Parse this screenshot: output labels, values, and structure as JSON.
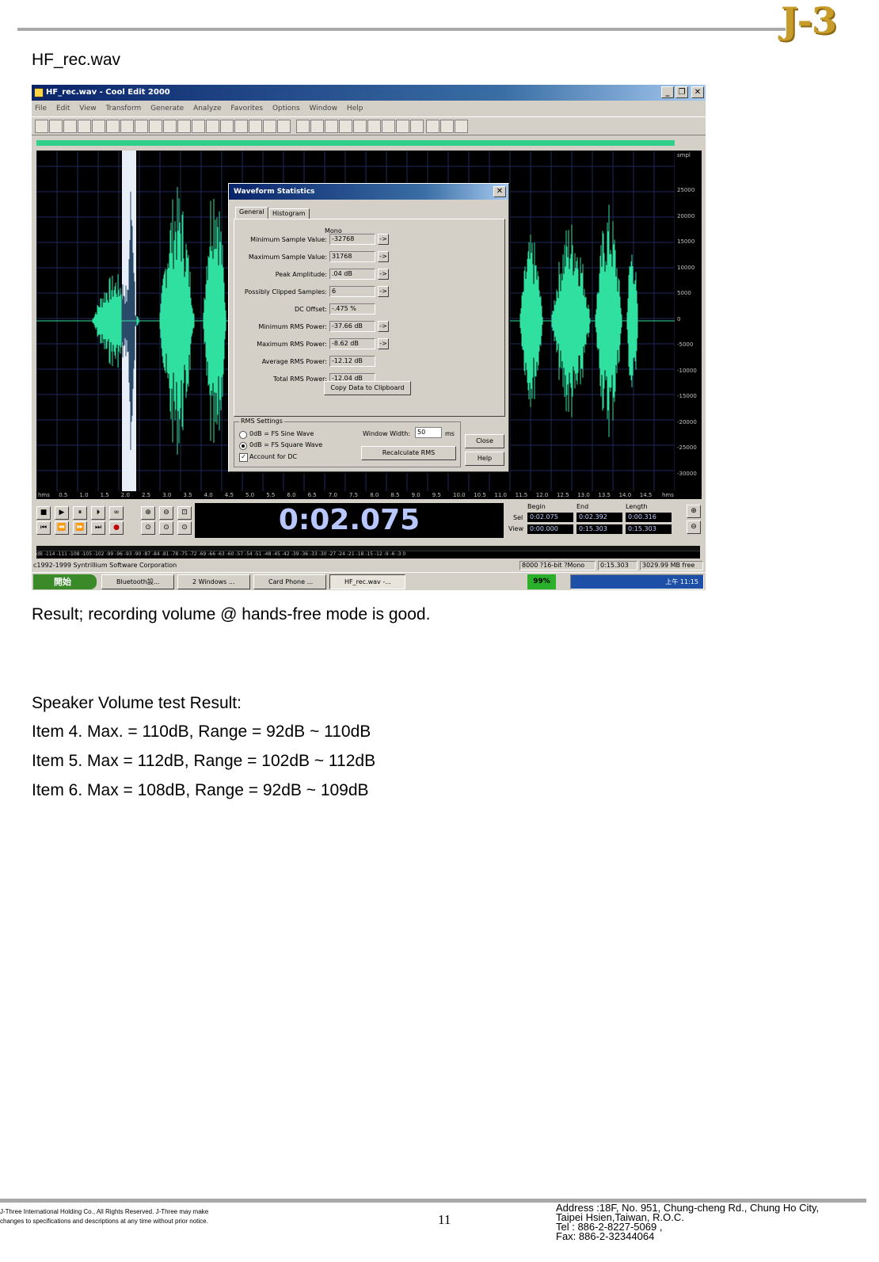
{
  "header": {
    "logo": "J-3",
    "doc_title": "HF_rec.wav"
  },
  "window": {
    "title": "HF_rec.wav - Cool Edit 2000",
    "menu": [
      "File",
      "Edit",
      "View",
      "Transform",
      "Generate",
      "Analyze",
      "Favorites",
      "Options",
      "Window",
      "Help"
    ],
    "scale_labels": [
      "smpl",
      "25000",
      "20000",
      "15000",
      "10000",
      "5000",
      "0",
      "-5000",
      "-10000",
      "-15000",
      "-20000",
      "-25000",
      "-30000"
    ],
    "ruler_labels": [
      "hms",
      "0.5",
      "1.0",
      "1.5",
      "2.0",
      "2.5",
      "3.0",
      "3.5",
      "4.0",
      "4.5",
      "5.0",
      "5.5",
      "6.0",
      "6.5",
      "7.0",
      "7.5",
      "8.0",
      "8.5",
      "9.0",
      "9.5",
      "10.0",
      "10.5",
      "11.0",
      "11.5",
      "12.0",
      "12.5",
      "13.0",
      "13.5",
      "14.0",
      "14.5",
      "hms"
    ],
    "time_display": "0:02.075",
    "selection": {
      "begin_label": "Begin",
      "end_label": "End",
      "length_label": "Length",
      "sel_label": "Sel",
      "view_label": "View",
      "sel_begin": "0:02.075",
      "sel_end": "0:02.392",
      "sel_length": "0:00.316",
      "view_begin": "0:00.000",
      "view_end": "0:15.303",
      "view_length": "0:15.303"
    },
    "level_scale": "dB  -114 -111 -108 -105 -102 -99 -96 -93 -90 -87 -84 -81 -78 -75 -72 -69 -66 -63 -60 -57 -54 -51 -48 -45 -42 -39 -36 -33 -30 -27 -24 -21 -18 -15 -12 -9 -6 -3 0",
    "status": {
      "copyright": "c1992-1999 Syntrillium Software Corporation",
      "format": "8000 ?16-bit ?Mono",
      "duration": "0:15.303",
      "free": "3029.99 MB free"
    },
    "taskbar": {
      "start": "開始",
      "tasks": [
        "Bluetooth設...",
        "2 Windows ...",
        "Card Phone ...",
        "HF_rec.wav -..."
      ],
      "battery": "99%",
      "clock": "上午 11:15"
    }
  },
  "dialog": {
    "title": "Waveform Statistics",
    "tabs": [
      "General",
      "Histogram"
    ],
    "channel": "Mono",
    "rows": [
      {
        "label": "Minimum Sample Value:",
        "value": "-32768",
        "arrow": "->"
      },
      {
        "label": "Maximum Sample Value:",
        "value": "31768",
        "arrow": "->"
      },
      {
        "label": "Peak Amplitude:",
        "value": ".04 dB",
        "arrow": "->"
      },
      {
        "label": "Possibly Clipped Samples:",
        "value": "6",
        "arrow": "->"
      },
      {
        "label": "DC Offset:",
        "value": "-.475 %",
        "arrow": ""
      },
      {
        "label": "Minimum RMS Power:",
        "value": "-37.66 dB",
        "arrow": "->"
      },
      {
        "label": "Maximum RMS Power:",
        "value": "-8.62 dB",
        "arrow": "->"
      },
      {
        "label": "Average RMS Power:",
        "value": "-12.12 dB",
        "arrow": ""
      },
      {
        "label": "Total RMS Power:",
        "value": "-12.04 dB",
        "arrow": ""
      }
    ],
    "copy_button": "Copy Data to Clipboard",
    "rms_group": "RMS Settings",
    "opt_sine": "0dB = FS Sine Wave",
    "opt_square": "0dB = FS Square Wave",
    "account_dc": "Account for DC",
    "window_width_label": "Window Width:",
    "window_width_value": "50",
    "window_width_unit": "ms",
    "recalc_button": "Recalculate RMS",
    "close_button": "Close",
    "help_button": "Help"
  },
  "body": {
    "result": "Result; recording volume @ hands-free mode is good.",
    "speaker_title": "Speaker Volume test Result:",
    "items": [
      "Item 4. Max. = 110dB, Range = 92dB ~ 110dB",
      "Item 5. Max = 112dB, Range = 102dB ~ 112dB",
      "Item 6. Max = 108dB, Range = 92dB ~ 109dB"
    ]
  },
  "footer": {
    "left_line1": "J-Three International Holding Co., All Rights Reserved. J-Three may make",
    "left_line2": "changes to specifications and descriptions at any time without prior notice.",
    "page": "11",
    "address1": "Address :18F, No. 951, Chung-cheng Rd., Chung Ho City,",
    "address2": "Taipei Hsien,Taiwan, R.O.C.",
    "tel": "Tel : 886-2-8227-5069 ,",
    "fax": "Fax: 886-2-32344064"
  }
}
